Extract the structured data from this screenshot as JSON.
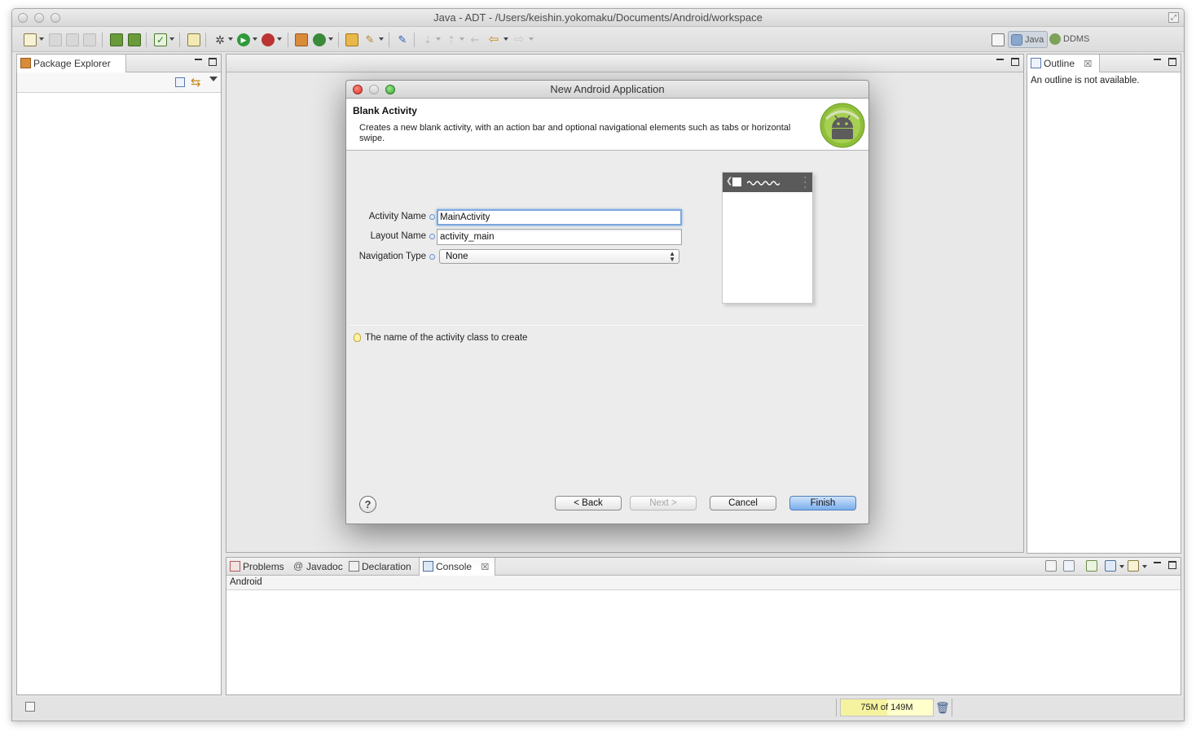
{
  "window": {
    "title": "Java - ADT - /Users/keishin.yokomaku/Documents/Android/workspace"
  },
  "perspectives": {
    "java": "Java",
    "ddms": "DDMS"
  },
  "package_explorer": {
    "tab_label": "Package Explorer"
  },
  "outline": {
    "tab_label": "Outline",
    "message": "An outline is not available."
  },
  "bottom_panel": {
    "tabs": [
      "Problems",
      "Javadoc",
      "Declaration",
      "Console"
    ],
    "active_tab": "Console",
    "console_title": "Android"
  },
  "dialog": {
    "title": "New Android Application",
    "header_title": "Blank Activity",
    "header_desc": "Creates a new blank activity, with an action bar and optional navigational elements such as tabs or horizontal swipe.",
    "fields": {
      "activity_name_label": "Activity Name",
      "activity_name_value": "MainActivity",
      "layout_name_label": "Layout Name",
      "layout_name_value": "activity_main",
      "navigation_type_label": "Navigation Type",
      "navigation_type_value": "None"
    },
    "hint": "The name of the activity class to create",
    "buttons": {
      "back": "< Back",
      "next": "Next >",
      "cancel": "Cancel",
      "finish": "Finish"
    }
  },
  "status": {
    "heap_text": "75M of 149M",
    "heap_used_fraction": 0.5
  }
}
